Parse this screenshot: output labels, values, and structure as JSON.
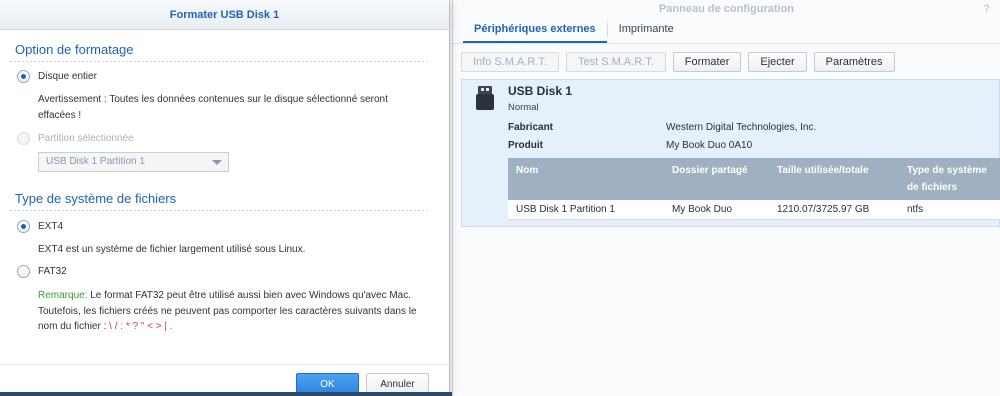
{
  "control_panel": {
    "title": "Panneau de configuration",
    "help": "?",
    "tabs": [
      {
        "label": "Périphériques externes",
        "active": true
      },
      {
        "label": "Imprimante",
        "active": false
      }
    ],
    "toolbar": [
      {
        "label": "Info S.M.A.R.T.",
        "enabled": false
      },
      {
        "label": "Test S.M.A.R.T.",
        "enabled": false
      },
      {
        "label": "Formater",
        "enabled": true
      },
      {
        "label": "Ejecter",
        "enabled": true
      },
      {
        "label": "Paramètres",
        "enabled": true
      }
    ],
    "disk": {
      "name": "USB Disk 1",
      "status": "Normal",
      "manufacturer_label": "Fabricant",
      "manufacturer": "Western Digital Technologies, Inc.",
      "product_label": "Produit",
      "product": "My Book Duo 0A10",
      "table": {
        "headers": [
          "Nom",
          "Dossier partagé",
          "Taille utilisée/totale",
          "Type de système de fichiers"
        ],
        "rows": [
          [
            "USB Disk 1 Partition 1",
            "My Book Duo",
            "1210.07/3725.97 GB",
            "ntfs"
          ]
        ]
      }
    }
  },
  "dialog": {
    "title": "Formater USB Disk 1",
    "format_section": "Option de formatage",
    "whole_disk_label": "Disque entier",
    "warning": "Avertissement : Toutes les données contenues sur le disque sélectionné seront effacées !",
    "partition_label": "Partition sélectionnée",
    "partition_select": "USB Disk 1 Partition 1",
    "fs_section": "Type de système de fichiers",
    "ext4_label": "EXT4",
    "ext4_desc": "EXT4 est un système de fichier largement utilisé sous Linux.",
    "fat32_label": "FAT32",
    "remark_label": "Remarque:",
    "remark_text": " Le format FAT32 peut être utilisé aussi bien avec Windows qu'avec Mac. Toutefois, les fichiers créés ne peuvent pas comporter les caractères suivants dans le nom du fichier : ",
    "forbidden_chars": "\\ / : * ? \" < > | .",
    "ok_label": "OK",
    "cancel_label": "Annuler"
  }
}
